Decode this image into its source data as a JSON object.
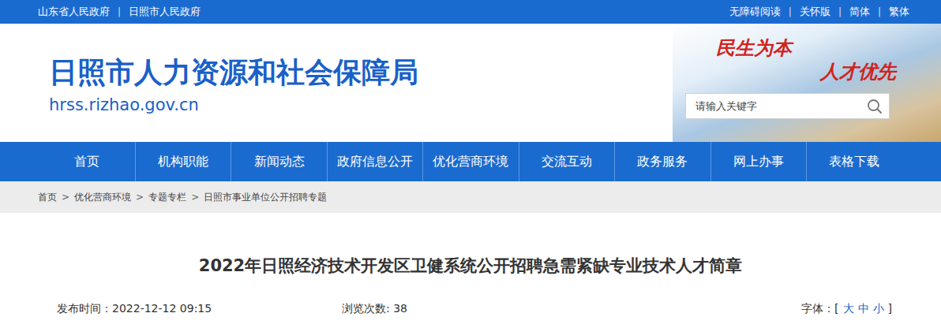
{
  "top_bar": {
    "left_links": [
      "山东省人民政府",
      "日照市人民政府"
    ],
    "right_links": [
      "无障碍阅读",
      "关怀版",
      "简体",
      "繁体"
    ],
    "separator": "|"
  },
  "header": {
    "title": "日照市人力资源和社会保障局",
    "domain": "hrss.rizhao.gov.cn",
    "slogan": [
      "民生为本",
      "人才优先"
    ],
    "search": {
      "placeholder": "请输入关键字"
    }
  },
  "nav": {
    "items": [
      "首页",
      "机构职能",
      "新闻动态",
      "政府信息公开",
      "优化营商环境",
      "交流互动",
      "政务服务",
      "网上办事",
      "表格下载"
    ]
  },
  "breadcrumb": {
    "items": [
      "首页",
      "优化营商环境",
      "专题专栏",
      "日照市事业单位公开招聘专题"
    ],
    "separator": ">"
  },
  "article": {
    "title": "2022年日照经济技术开发区卫健系统公开招聘急需紧缺专业技术人才简章",
    "meta": {
      "published_label": "发布时间：",
      "published": "2022-12-12 09:15",
      "views_label": "浏览次数: ",
      "views": "38",
      "font_label": "字体：",
      "font_open": "[",
      "font_sizes": [
        "大",
        "中",
        "小"
      ],
      "font_close": "]"
    }
  }
}
